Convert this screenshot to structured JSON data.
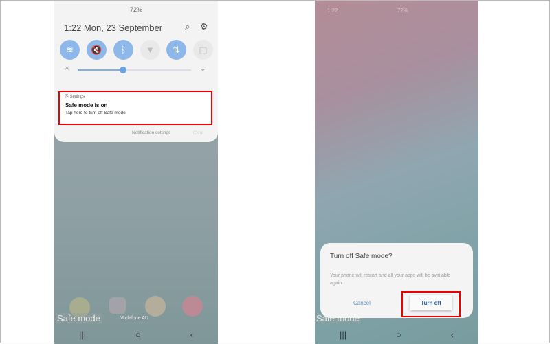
{
  "left": {
    "status": "72%",
    "datetime": "1:22  Mon, 23 September",
    "quick_settings": [
      {
        "name": "wifi",
        "glyph": "≋",
        "on": true
      },
      {
        "name": "sound",
        "glyph": "🔇",
        "on": true
      },
      {
        "name": "bluetooth",
        "glyph": "ᛒ",
        "on": true
      },
      {
        "name": "flashlight",
        "glyph": "▼",
        "on": false
      },
      {
        "name": "mobile-data",
        "glyph": "⇅",
        "on": true
      },
      {
        "name": "power-saving",
        "glyph": "▢",
        "on": false
      }
    ],
    "brightness": 0.4,
    "notification": {
      "app": "Settings",
      "title": "Safe mode is on",
      "body": "Tap here to turn off Safe mode."
    },
    "notification_settings": "Notification settings",
    "clear": "Clear",
    "carrier": "Vodafone AU",
    "watermark": "Safe mode"
  },
  "right": {
    "status_time": "1:22",
    "status": "72%",
    "dialog": {
      "title": "Turn off Safe mode?",
      "body": "Your phone will restart and all your apps will be available again.",
      "cancel": "Cancel",
      "confirm": "Turn off"
    },
    "watermark": "Safe mode"
  },
  "nav": {
    "recents": "|||",
    "home": "○",
    "back": "‹"
  },
  "accent": "#8fb8ea",
  "highlight": "#e00000"
}
